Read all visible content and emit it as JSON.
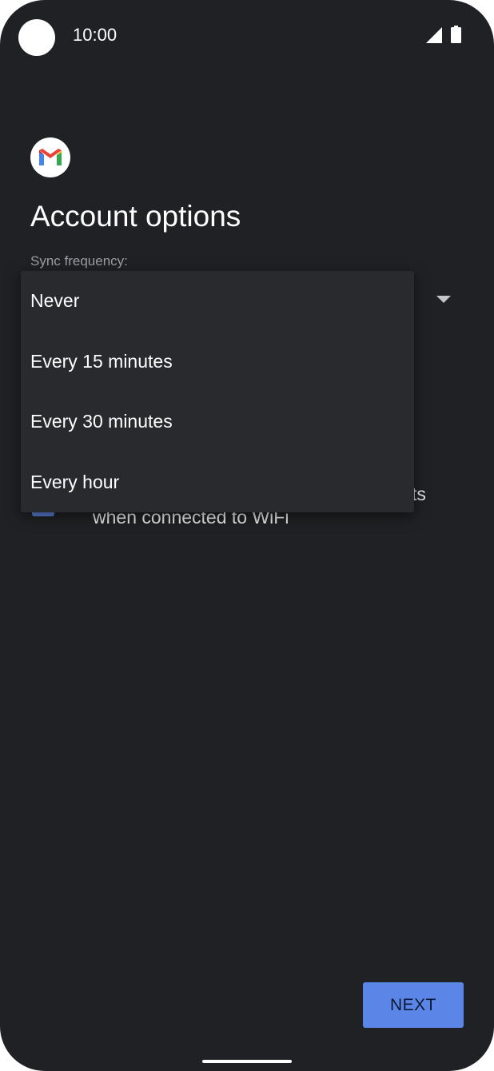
{
  "status_bar": {
    "time": "10:00",
    "icons": [
      "camera-cutout",
      "signal-icon",
      "battery-icon"
    ]
  },
  "app": {
    "logo_icon": "gmail-icon"
  },
  "page": {
    "title": "Account options",
    "sync_label": "Sync frequency:"
  },
  "dropdown": {
    "options": [
      "Never",
      "Every 15 minutes",
      "Every 30 minutes",
      "Every hour"
    ]
  },
  "background_option": {
    "text_tail": "ts",
    "text_line2": "when connected to WiFi"
  },
  "footer": {
    "next_label": "NEXT"
  },
  "colors": {
    "background": "#202124",
    "menu": "#292a2d",
    "accent": "#5b85e6"
  }
}
